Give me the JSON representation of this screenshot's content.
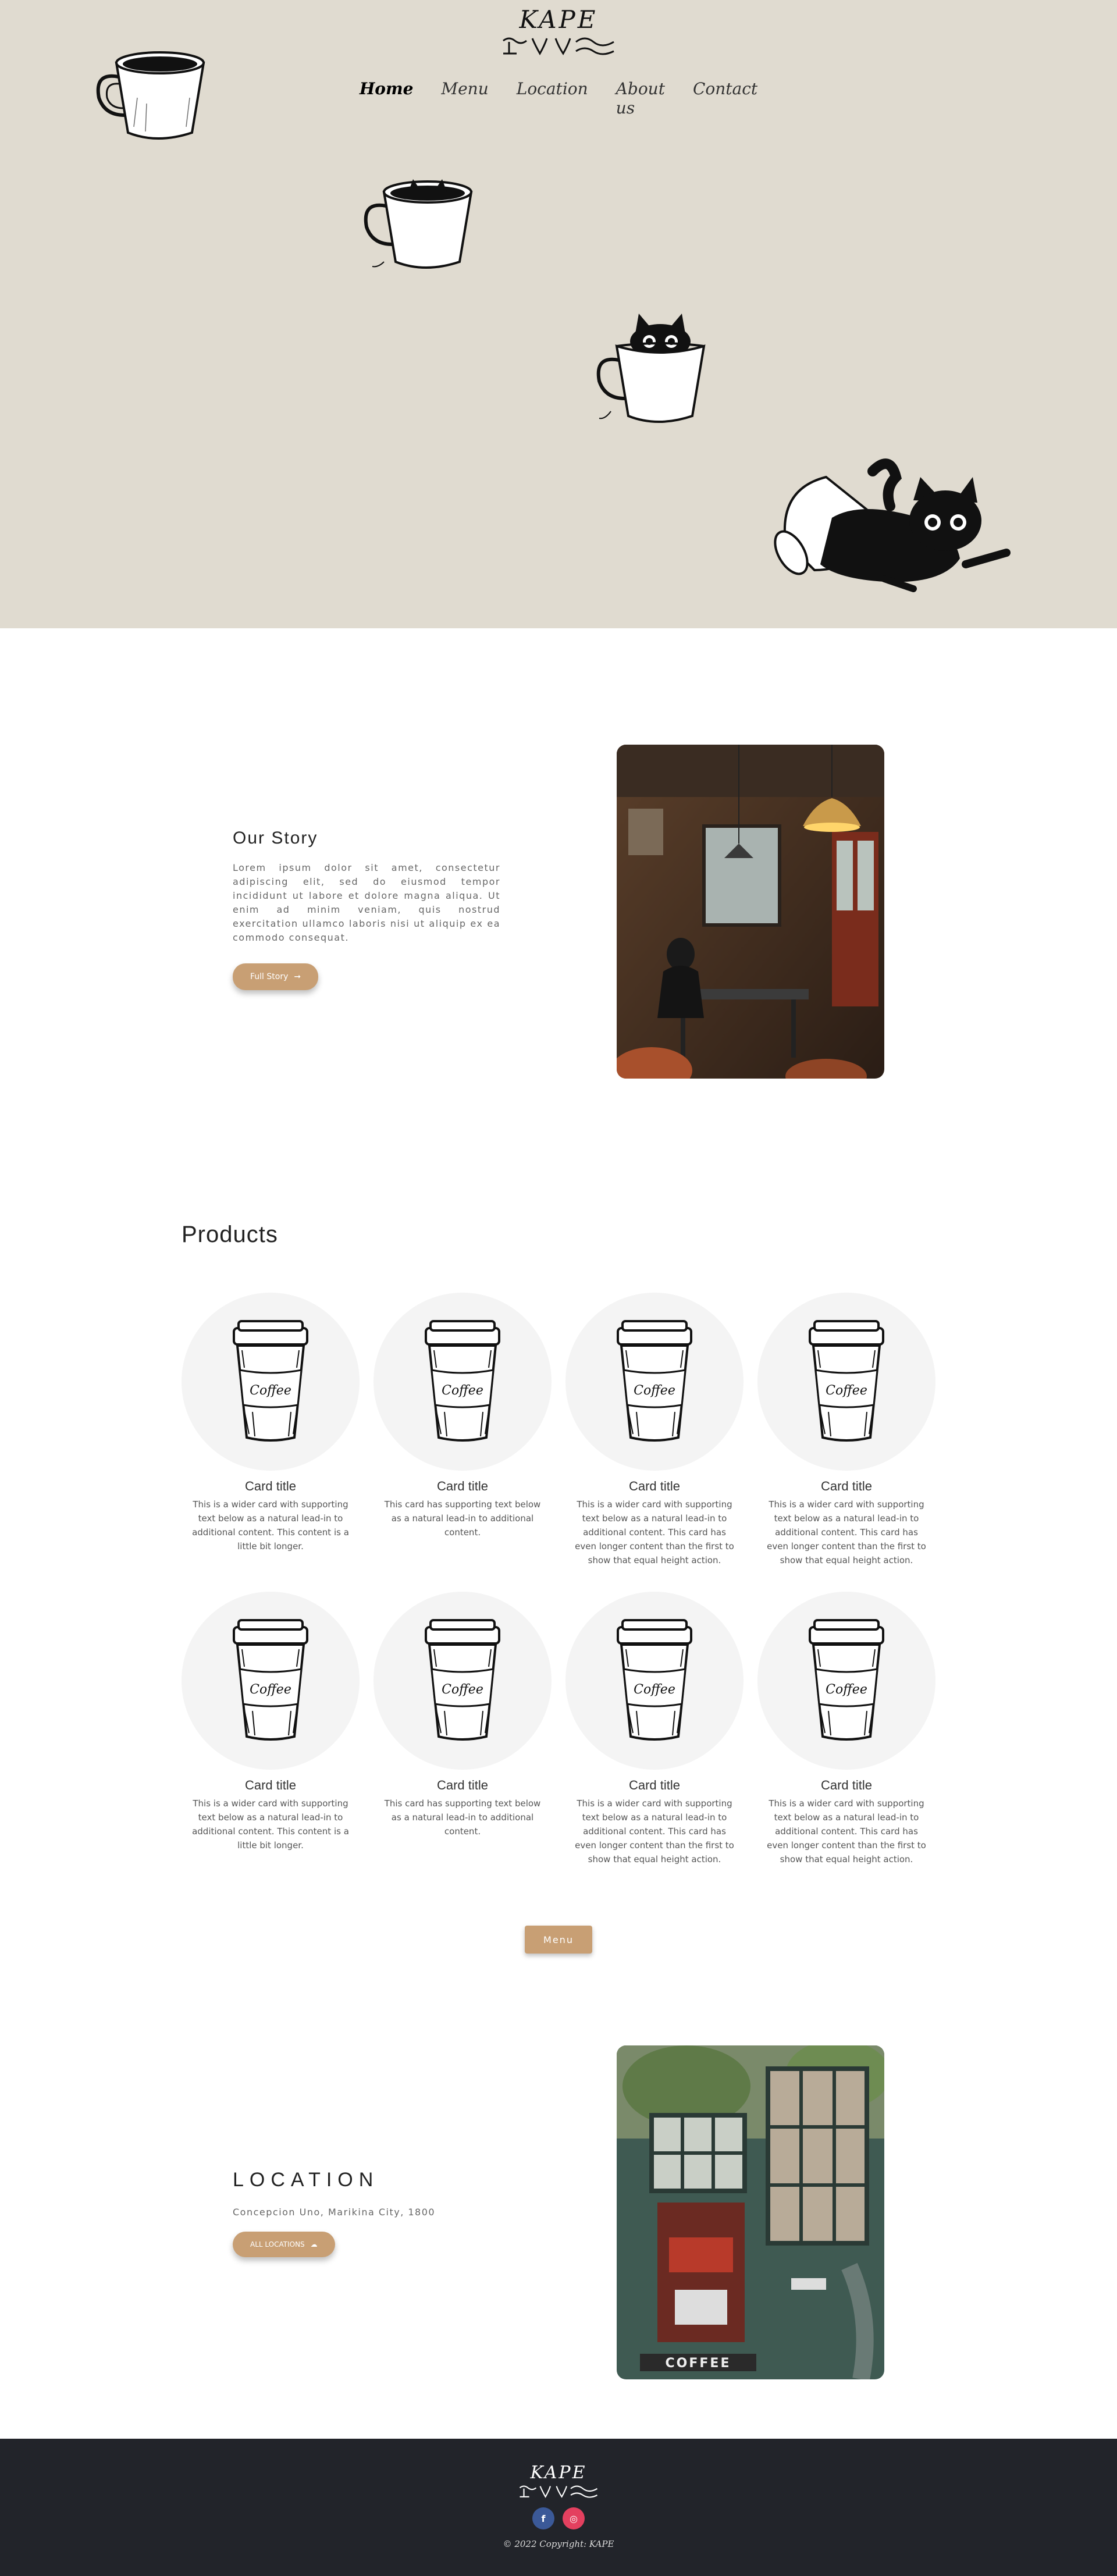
{
  "brand": {
    "logo_text": "KAPE"
  },
  "nav": {
    "items": [
      {
        "label": "Home"
      },
      {
        "label": "Menu"
      },
      {
        "label": "Location"
      },
      {
        "label": "About us"
      },
      {
        "label": "Contact"
      }
    ]
  },
  "story": {
    "title": "Our Story",
    "body": "Lorem ipsum dolor sit amet, consectetur adipiscing elit, sed do eiusmod tempor incididunt ut labore et dolore magna aliqua. Ut enim ad minim veniam, quis nostrud exercitation ullamco laboris nisi ut aliquip ex ea commodo consequat.",
    "button_label": "Full Story",
    "button_icon": "arrow-right-icon"
  },
  "products": {
    "title": "Products",
    "cards": [
      {
        "title": "Card title",
        "text": "This is a wider card with supporting text below as a natural lead-in to additional content. This content is a little bit longer."
      },
      {
        "title": "Card title",
        "text": "This card has supporting text below as a natural lead-in to additional content."
      },
      {
        "title": "Card title",
        "text": "This is a wider card with supporting text below as a natural lead-in to additional content. This card has even longer content than the first to show that equal height action."
      },
      {
        "title": "Card title",
        "text": "This is a wider card with supporting text below as a natural lead-in to additional content. This card has even longer content than the first to show that equal height action."
      },
      {
        "title": "Card title",
        "text": "This is a wider card with supporting text below as a natural lead-in to additional content. This content is a little bit longer."
      },
      {
        "title": "Card title",
        "text": "This card has supporting text below as a natural lead-in to additional content."
      },
      {
        "title": "Card title",
        "text": "This is a wider card with supporting text below as a natural lead-in to additional content. This card has even longer content than the first to show that equal height action."
      },
      {
        "title": "Card title",
        "text": "This is a wider card with supporting text below as a natural lead-in to additional content. This card has even longer content than the first to show that equal height action."
      }
    ],
    "cup_label": "Coffee",
    "menu_button_label": "Menu"
  },
  "location": {
    "title": "LOCATION",
    "address": "Concepcion Uno, Marikina City, 1800",
    "button_label": "ALL LOCATIONS",
    "button_icon": "cloud-icon",
    "storefront_sign": "COFFEE"
  },
  "footer": {
    "logo_text": "KAPE",
    "social": [
      {
        "name": "facebook-icon",
        "glyph": "f"
      },
      {
        "name": "instagram-icon",
        "glyph": "◎"
      }
    ],
    "copyright": "© 2022 Copyright: KAPE"
  },
  "colors": {
    "hero_bg": "#e0dbd0",
    "accent": "#c89f74",
    "footer_bg": "#22242a",
    "facebook": "#3b5998",
    "instagram": "#e4405f"
  }
}
